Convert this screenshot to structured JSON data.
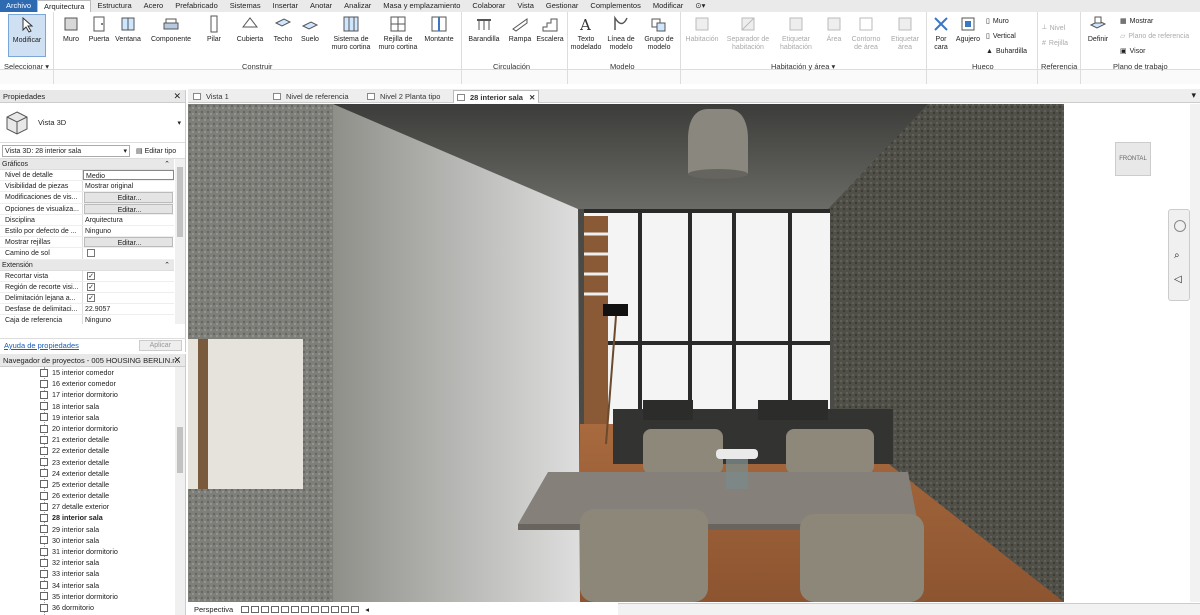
{
  "menubar": {
    "items": [
      "Archivo",
      "Arquitectura",
      "Estructura",
      "Acero",
      "Prefabricado",
      "Sistemas",
      "Insertar",
      "Anotar",
      "Analizar",
      "Masa y emplazamiento",
      "Colaborar",
      "Vista",
      "Gestionar",
      "Complementos",
      "Modificar"
    ],
    "file_color": "#2e6ab2"
  },
  "ribbon": {
    "buttons": {
      "modificar": "Modificar",
      "muro": "Muro",
      "puerta": "Puerta",
      "ventana": "Ventana",
      "componente": "Componente",
      "pilar": "Pilar",
      "cubierta": "Cubierta",
      "techo": "Techo",
      "suelo": "Suelo",
      "sistema_muro": "Sistema de muro cortina",
      "rejilla_muro": "Rejilla de muro cortina",
      "montante": "Montante",
      "barandilla": "Barandilla",
      "rampa": "Rampa",
      "escalera": "Escalera",
      "texto_modelado": "Texto modelado",
      "linea_modelo": "Línea de modelo",
      "grupo_modelo": "Grupo de modelo",
      "habitacion": "Habitación",
      "separador": "Separador de habitación",
      "etiquetar_hab": "Etiquetar habitación",
      "area": "Área",
      "contorno": "Contorno de área",
      "etiquetar_area": "Etiquetar área",
      "por_cara": "Por cara",
      "agujero": "Agujero",
      "definir": "Definir"
    },
    "small": {
      "muro": "Muro",
      "vertical": "Vertical",
      "buhardilla": "Buhardilla",
      "nivel": "Nivel",
      "rejilla": "Rejilla",
      "mostrar": "Mostrar",
      "plano_ref": "Plano de referencia",
      "visor": "Visor"
    },
    "panels": {
      "seleccionar": "Seleccionar",
      "construir": "Construir",
      "circulacion": "Circulación",
      "modelo": "Modelo",
      "habitacion_area": "Habitación y área",
      "hueco": "Hueco",
      "referencia": "Referencia",
      "plano_trabajo": "Plano de trabajo"
    }
  },
  "properties": {
    "title": "Propiedades",
    "type_name": "Vista 3D",
    "instance": "Vista 3D: 28 interior sala",
    "edit_type": "Editar tipo",
    "group_graphics": "Gráficos",
    "group_extension": "Extensión",
    "rows_graphics": [
      {
        "k": "Nivel de detalle",
        "v": "Medio",
        "kind": "inp"
      },
      {
        "k": "Visibilidad de piezas",
        "v": "Mostrar original",
        "kind": "txt"
      },
      {
        "k": "Modificaciones de vis...",
        "v": "Editar...",
        "kind": "btn"
      },
      {
        "k": "Opciones de visualiza...",
        "v": "Editar...",
        "kind": "btn"
      },
      {
        "k": "Disciplina",
        "v": "Arquitectura",
        "kind": "txt"
      },
      {
        "k": "Estilo por defecto de ...",
        "v": "Ninguno",
        "kind": "txt"
      },
      {
        "k": "Mostrar rejillas",
        "v": "Editar...",
        "kind": "btn"
      },
      {
        "k": "Camino de sol",
        "v": "",
        "kind": "chk0"
      }
    ],
    "rows_extension": [
      {
        "k": "Recortar vista",
        "v": "",
        "kind": "chk1"
      },
      {
        "k": "Región de recorte visi...",
        "v": "",
        "kind": "chk1"
      },
      {
        "k": "Delimitación lejana a...",
        "v": "",
        "kind": "chk1"
      },
      {
        "k": "Desfase de delimitaci...",
        "v": "22.9057",
        "kind": "txt"
      },
      {
        "k": "Caja de referencia",
        "v": "Ninguno",
        "kind": "txt"
      },
      {
        "k": "Caja de sección",
        "v": "",
        "kind": "txt"
      }
    ],
    "help_link": "Ayuda de propiedades",
    "apply": "Aplicar"
  },
  "browser": {
    "title": "Navegador de proyectos - 005 HOUSING BERLIN.r...",
    "items": [
      "15 interior comedor",
      "16 exterior comedor",
      "17 interior dormitorio",
      "18 interior sala",
      "19 interior sala",
      "20 interior dormitorio",
      "21 exterior detalle",
      "22 exterior detalle",
      "23 exterior detalle",
      "24 exterior detalle",
      "25 exterior detalle",
      "26 exterior detalle",
      "27 detalle exterior",
      "28 interior sala",
      "29 interior sala",
      "30 interior sala",
      "31 interior dormitorio",
      "32 interior sala",
      "33 interior sala",
      "34 interior sala",
      "35 interior dormitorio",
      "36 dormitorio"
    ],
    "selected": "28 interior sala"
  },
  "tabs": [
    "Vista 1",
    "Nivel de referencia",
    "Nivel 2 Planta tipo",
    "28 interior sala"
  ],
  "active_tab": "28 interior sala",
  "status": {
    "view_mode": "Perspectiva"
  },
  "viewcube": {
    "face": "FRONTAL"
  }
}
